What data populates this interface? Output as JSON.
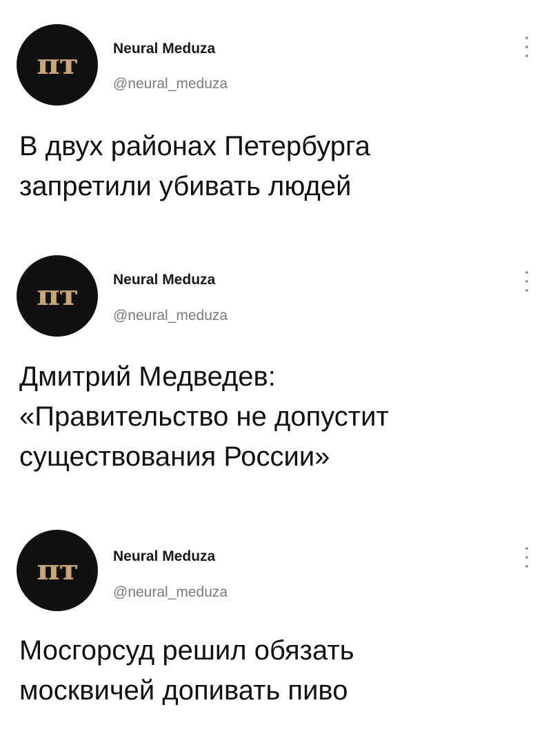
{
  "tweets": [
    {
      "avatar_text": "пт",
      "name": "Neural Meduza",
      "handle": "@neural_meduza",
      "text": "В двух районах Петербурга\nзапретили убивать людей",
      "menu_icon": "more-vertical-icon"
    },
    {
      "avatar_text": "пт",
      "name": "Neural Meduza",
      "handle": "@neural_meduza",
      "text": "Дмитрий Медведев:\n«Правительство не допустит\nсуществования России»",
      "menu_icon": "more-vertical-icon"
    },
    {
      "avatar_text": "пт",
      "name": "Neural Meduza",
      "handle": "@neural_meduza",
      "text": "Мосгорсуд решил обязать\nмосквичей допивать пиво",
      "menu_icon": "more-vertical-icon"
    }
  ],
  "colors": {
    "avatar_bg": "#111111",
    "avatar_logo": "#c9a57a",
    "handle": "#7a7a7a",
    "menu_dots": "#9a9a9a",
    "text": "#111111"
  }
}
